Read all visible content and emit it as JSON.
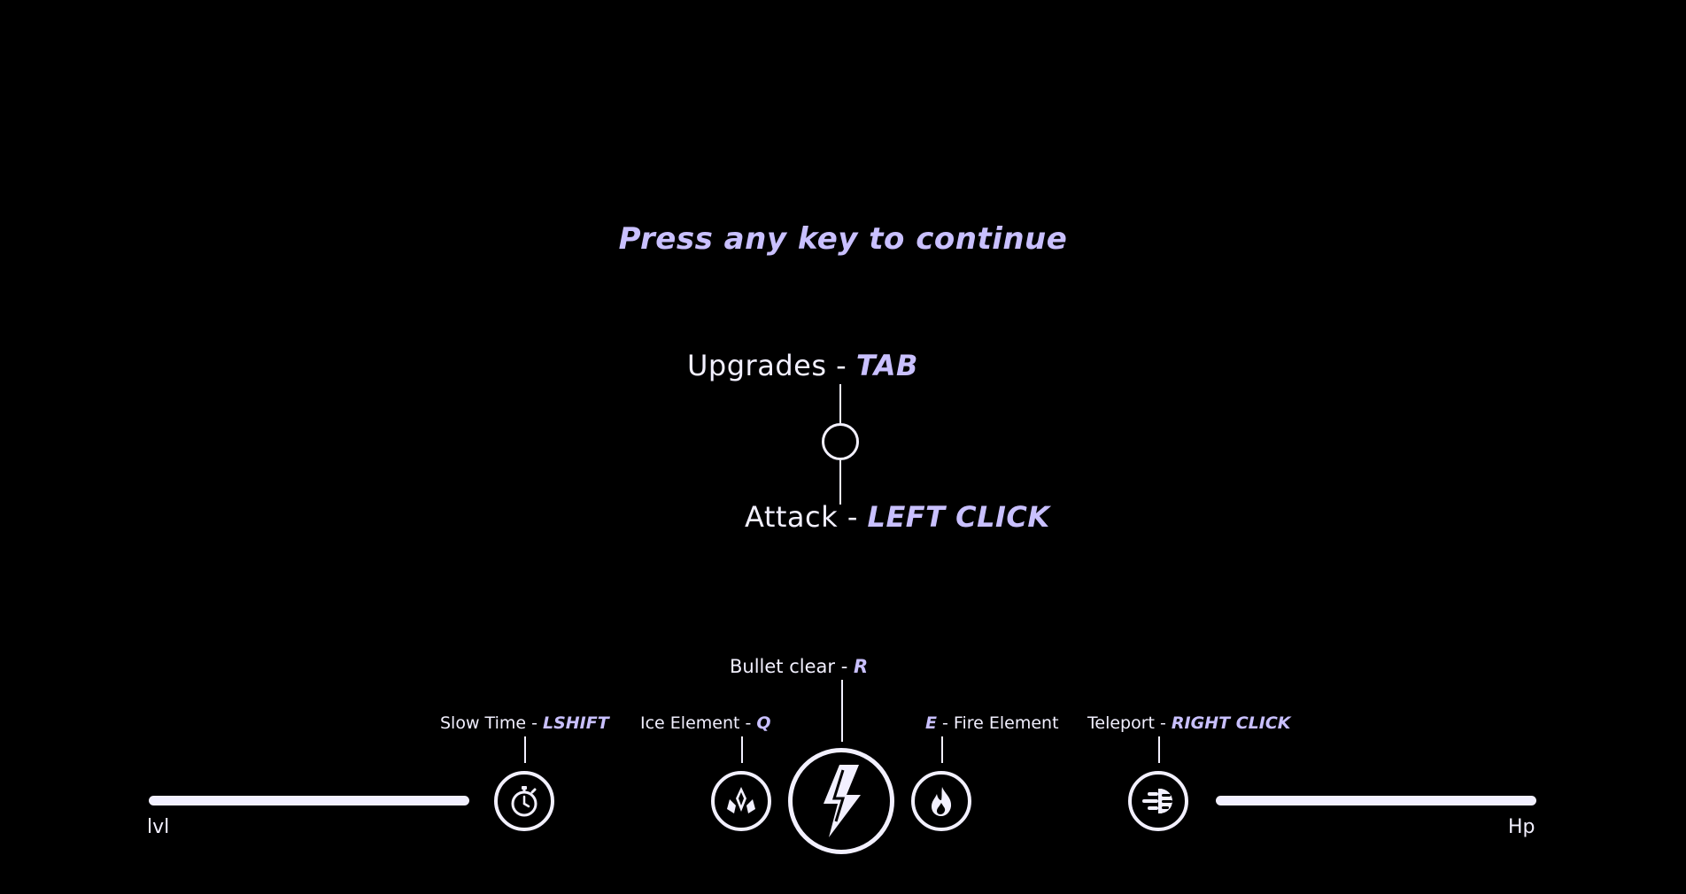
{
  "prompt": "Press any key to continue",
  "controls": {
    "upgrades": {
      "label": "Upgrades - ",
      "key": "TAB"
    },
    "attack": {
      "label": "Attack - ",
      "key": "LEFT CLICK"
    },
    "bullet_clear": {
      "label": "Bullet clear - ",
      "key": "R"
    },
    "slow_time": {
      "label": "Slow Time - ",
      "key": "LSHIFT"
    },
    "ice_element": {
      "label": "Ice Element - ",
      "key": "Q"
    },
    "fire_element": {
      "key": "E",
      "label": " - Fire Element"
    },
    "teleport": {
      "label": "Teleport - ",
      "key": "RIGHT CLICK"
    }
  },
  "hud": {
    "level_label": "lvl",
    "hp_label": "Hp",
    "level_bar": {
      "fill": 1.0
    },
    "hp_bar": {
      "fill": 1.0
    }
  },
  "icons": {
    "slow_time": "stopwatch-icon",
    "ice_element": "ice-crystal-icon",
    "bullet_clear": "lightning-bolt-icon",
    "fire_element": "flame-icon",
    "teleport": "dash-icon"
  },
  "colors": {
    "background": "#000000",
    "text": "#f2f0ff",
    "accent": "#c9c0ff"
  }
}
